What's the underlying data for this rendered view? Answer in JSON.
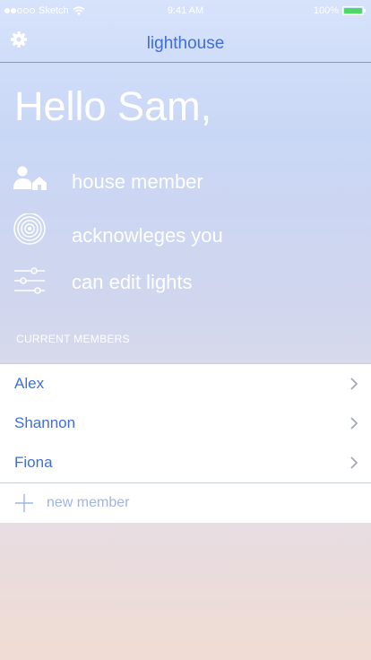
{
  "status_bar": {
    "carrier": "Sketch",
    "time": "9:41 AM",
    "battery": "100%",
    "signal_dots_filled": 2,
    "signal_dots_total": 5
  },
  "nav": {
    "title": "lighthouse",
    "settings_icon": "gear-icon"
  },
  "greeting": "Hello Sam,",
  "permissions": [
    {
      "icon": "house-member-icon",
      "label": "house member"
    },
    {
      "icon": "broadcast-icon",
      "label": "acknowleges you"
    },
    {
      "icon": "sliders-icon",
      "label": "can edit lights"
    }
  ],
  "members": {
    "header": "CURRENT MEMBERS",
    "items": [
      {
        "name": "Alex"
      },
      {
        "name": "Shannon"
      },
      {
        "name": "Fiona"
      }
    ],
    "add_label": "new member"
  },
  "colors": {
    "accent": "#3f6fd6",
    "add_text": "#9eb4e6",
    "battery": "#4cd964"
  }
}
